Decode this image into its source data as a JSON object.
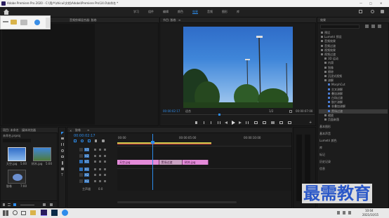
{
  "window": {
    "title": "Adobe Premiere Pro 2020 - C:\\用户\\zhicui\\文档\\Adobe\\Premiere Pro\\14.0\\未命名 *",
    "controls": {
      "minimize": "—",
      "maximize": "□",
      "close": "✕"
    }
  },
  "workspace_tabs": [
    "学习",
    "组件",
    "编辑",
    "颜色",
    "效果",
    "音频",
    "图形",
    "库"
  ],
  "active_workspace": "效果",
  "source_panel": {
    "tab1": "源:(无剪辑)",
    "tab2": "效果控件",
    "tab3": "音频剪辑混合器: 胶卷",
    "no_clip_text": "(无剪辑)"
  },
  "program_monitor": {
    "title": "节目: 胶卷",
    "menu_icon": "≡",
    "timecode_current": "00:00:02:17",
    "fit_label": "适合",
    "resolution_label": "1/2",
    "timecode_total": "00:00:07:00"
  },
  "effects_panel": {
    "title": "效果",
    "items": [
      {
        "label": "预设",
        "level": 0
      },
      {
        "label": "Lumetri 预设",
        "level": 0
      },
      {
        "label": "音频效果",
        "level": 0
      },
      {
        "label": "音频过渡",
        "level": 0
      },
      {
        "label": "视频效果",
        "level": 0
      },
      {
        "label": "视频过渡",
        "level": 0
      },
      {
        "label": "3D 运动",
        "level": 1
      },
      {
        "label": "内滑",
        "level": 1
      },
      {
        "label": "划像",
        "level": 1
      },
      {
        "label": "擦除",
        "level": 1
      },
      {
        "label": "沉浸式视频",
        "level": 1
      },
      {
        "label": "溶解",
        "level": 1
      },
      {
        "label": "MorphCut",
        "level": 2
      },
      {
        "label": "交叉溶解",
        "level": 2
      },
      {
        "label": "叠加溶解",
        "level": 2
      },
      {
        "label": "白场过渡",
        "level": 2
      },
      {
        "label": "胶片溶解",
        "level": 2
      },
      {
        "label": "非叠加溶解",
        "level": 2
      },
      {
        "label": "黑场过渡",
        "level": 2
      },
      {
        "label": "缩放",
        "level": 1
      },
      {
        "label": "页面剥落",
        "level": 1
      }
    ],
    "selected": "黑场过渡",
    "side_list": [
      "基本图形",
      "基本声音",
      "Lumetri 颜色",
      "库",
      "标记",
      "历史记录",
      "信息"
    ]
  },
  "project_panel": {
    "tab1": "项目: 未命名",
    "tab2": "媒体浏览器",
    "filename": "未命名.prproj",
    "clips": [
      {
        "name": "天空.jpg",
        "duration": "5:00"
      },
      {
        "name": "树木.jpg",
        "duration": "5:00"
      },
      {
        "name": "胶卷",
        "duration": "7:00"
      }
    ]
  },
  "timeline": {
    "title": "胶卷",
    "menu_icon": "≡",
    "timecode": "00:00:02:17",
    "ruler_labels": [
      "00:00",
      "00:00:05:00",
      "00:00:10:00"
    ],
    "tracks": [
      {
        "name": "V3",
        "type": "video"
      },
      {
        "name": "V2",
        "type": "video"
      },
      {
        "name": "V1",
        "type": "video"
      },
      {
        "name": "A1",
        "type": "audio"
      },
      {
        "name": "A2",
        "type": "audio"
      },
      {
        "name": "A3",
        "type": "audio"
      }
    ],
    "master_label": "主声道",
    "master_value": "0.0",
    "clips": [
      {
        "name": "天空.jpg",
        "start_sec": 0.0,
        "end_sec": 3.2,
        "track": "V1"
      },
      {
        "name": "黑场过渡",
        "start_sec": 3.2,
        "end_sec": 5.0,
        "track": "V1"
      },
      {
        "name": "树木.jpg",
        "start_sec": 5.0,
        "end_sec": 7.0,
        "track": "V1"
      }
    ],
    "playhead_sec": 2.7
  },
  "watermark": "最需教育",
  "taskbar": {
    "search_placeholder": "在这里输入你要搜索的内容",
    "time": "10:04",
    "date": "2021/10/15"
  },
  "colors": {
    "accent": "#2d8ceb",
    "clip": "#e38ad8",
    "transition": "#c9a1c1",
    "watermark": "#2a57c8"
  }
}
